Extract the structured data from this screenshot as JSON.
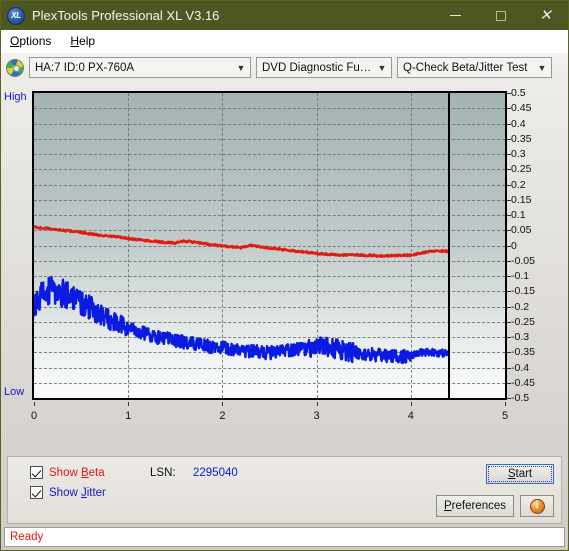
{
  "window": {
    "title": "PlexTools Professional XL V3.16",
    "app_icon": "xl-logo-icon",
    "minimize_label": "Minimize",
    "maximize_label": "Maximize",
    "close_label": "Close",
    "titlebar_color": "#4e5622"
  },
  "menubar": {
    "items": [
      {
        "label": "Options",
        "mnemonic": "O"
      },
      {
        "label": "Help",
        "mnemonic": "H"
      }
    ]
  },
  "toolbar": {
    "drive_icon": "optical-disc-icon",
    "drive_select": "HA:7 ID:0  PX-760A",
    "function_select": "DVD Diagnostic Functions",
    "test_select": "Q-Check Beta/Jitter Test"
  },
  "chart_labels": {
    "high": "High",
    "low": "Low"
  },
  "controls": {
    "show_beta_label": "Show Beta",
    "show_beta_mnemonic": "B",
    "show_beta_checked": true,
    "show_beta_color": "#e01b10",
    "show_jitter_label": "Show Jitter",
    "show_jitter_mnemonic": "J",
    "show_jitter_checked": true,
    "show_jitter_color": "#1414d0",
    "lsn_label": "LSN:",
    "lsn_value": "2295040",
    "start_label": "Start",
    "start_mnemonic": "S",
    "preferences_label": "Preferences",
    "preferences_mnemonic": "P",
    "info_icon": "info-icon"
  },
  "statusbar": {
    "text": "Ready",
    "color": "#e01b10"
  },
  "chart_data": {
    "type": "line",
    "title": "Q-Check Beta/Jitter Test",
    "xlabel": "",
    "ylabel": "",
    "xlim": [
      0,
      5
    ],
    "ylim": [
      -0.5,
      0.5
    ],
    "xticks": [
      0,
      1,
      2,
      3,
      4,
      5
    ],
    "yticks": [
      0.5,
      0.45,
      0.4,
      0.35,
      0.3,
      0.25,
      0.2,
      0.15,
      0.1,
      0.05,
      0,
      -0.05,
      -0.1,
      -0.15,
      -0.2,
      -0.25,
      -0.3,
      -0.35,
      -0.4,
      -0.45,
      -0.5
    ],
    "grid": true,
    "legend_position": "bottom-left",
    "data_end_x": 4.4,
    "axis_left_label": "High",
    "axis_bottom_left_label": "Low",
    "series": [
      {
        "name": "Show Beta",
        "color": "#e01b10",
        "x": [
          0.0,
          0.1,
          0.2,
          0.3,
          0.4,
          0.5,
          0.6,
          0.7,
          0.8,
          0.9,
          1.0,
          1.1,
          1.2,
          1.3,
          1.4,
          1.5,
          1.6,
          1.7,
          1.8,
          1.9,
          2.0,
          2.1,
          2.2,
          2.3,
          2.4,
          2.5,
          2.6,
          2.7,
          2.8,
          2.9,
          3.0,
          3.1,
          3.2,
          3.3,
          3.4,
          3.5,
          3.6,
          3.7,
          3.8,
          3.9,
          4.0,
          4.1,
          4.2,
          4.3,
          4.4
        ],
        "values": [
          0.06,
          0.057,
          0.054,
          0.05,
          0.047,
          0.043,
          0.038,
          0.034,
          0.03,
          0.028,
          0.023,
          0.019,
          0.016,
          0.013,
          0.01,
          0.008,
          0.015,
          0.011,
          0.006,
          0.002,
          -0.001,
          -0.004,
          -0.007,
          0.0,
          -0.004,
          -0.008,
          -0.012,
          -0.016,
          -0.019,
          -0.022,
          -0.026,
          -0.028,
          -0.031,
          -0.031,
          -0.03,
          -0.032,
          -0.033,
          -0.034,
          -0.033,
          -0.032,
          -0.032,
          -0.025,
          -0.02,
          -0.018,
          -0.019
        ]
      },
      {
        "name": "Show Jitter",
        "color": "#0a1ae0",
        "x": [
          0.0,
          0.1,
          0.2,
          0.3,
          0.4,
          0.5,
          0.6,
          0.7,
          0.8,
          0.9,
          1.0,
          1.1,
          1.2,
          1.3,
          1.4,
          1.5,
          1.6,
          1.7,
          1.8,
          1.9,
          2.0,
          2.1,
          2.2,
          2.3,
          2.4,
          2.5,
          2.6,
          2.7,
          2.8,
          2.9,
          3.0,
          3.1,
          3.2,
          3.3,
          3.4,
          3.5,
          3.6,
          3.7,
          3.8,
          3.9,
          4.0,
          4.1,
          4.2,
          4.3,
          4.4
        ],
        "values": [
          -0.175,
          -0.16,
          -0.15,
          -0.155,
          -0.165,
          -0.185,
          -0.205,
          -0.225,
          -0.245,
          -0.26,
          -0.27,
          -0.28,
          -0.29,
          -0.3,
          -0.305,
          -0.312,
          -0.318,
          -0.322,
          -0.328,
          -0.333,
          -0.336,
          -0.34,
          -0.343,
          -0.346,
          -0.349,
          -0.352,
          -0.35,
          -0.345,
          -0.338,
          -0.34,
          -0.336,
          -0.33,
          -0.338,
          -0.346,
          -0.352,
          -0.356,
          -0.358,
          -0.362,
          -0.363,
          -0.364,
          -0.363,
          -0.352,
          -0.348,
          -0.352,
          -0.354
        ]
      }
    ]
  }
}
